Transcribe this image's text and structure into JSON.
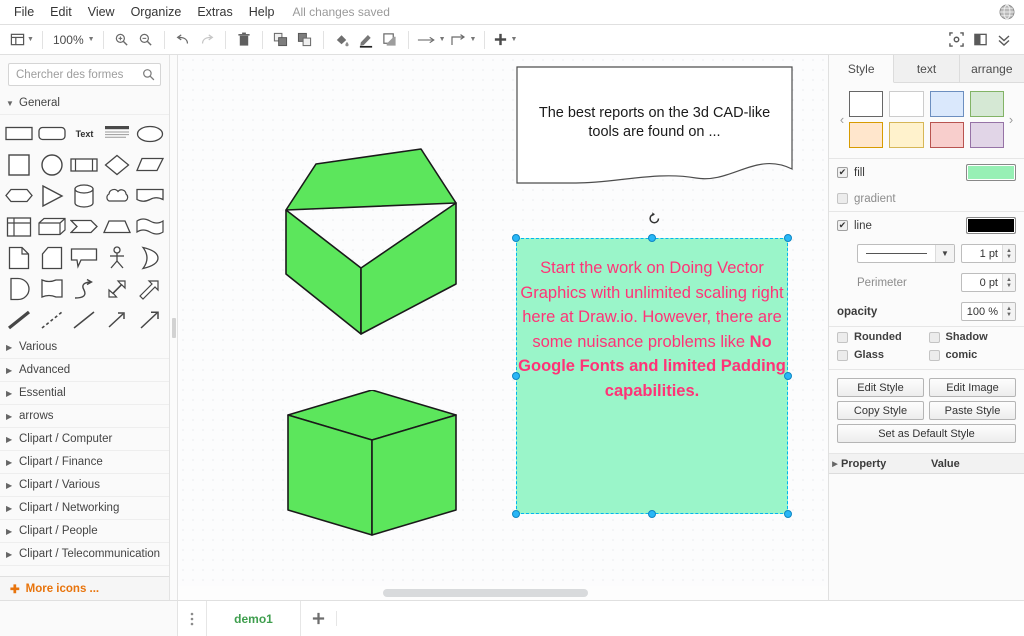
{
  "menubar": {
    "items": [
      "File",
      "Edit",
      "View",
      "Organize",
      "Extras",
      "Help"
    ],
    "status": "All changes saved",
    "language_icon": "globe-icon"
  },
  "toolbar": {
    "view_icon": "view-layout-icon",
    "zoom_level": "100%",
    "zoom_in_icon": "zoom-in-icon",
    "zoom_out_icon": "zoom-out-icon",
    "undo_icon": "undo-icon",
    "redo_icon": "redo-icon",
    "delete_icon": "trash-icon",
    "to_front_icon": "bring-to-front-icon",
    "to_back_icon": "send-to-back-icon",
    "fill_color_icon": "fill-color-icon",
    "line_color_icon": "line-color-icon",
    "shadow_icon": "shadow-icon",
    "waypoints_icon": "straight-connector-icon",
    "connection_icon": "elbow-connector-icon",
    "insert_icon": "plus-icon",
    "fullscreen_icon": "fullscreen-icon",
    "format_panel_icon": "format-panel-icon",
    "collapse_icon": "double-chevron-down-icon"
  },
  "sidebar": {
    "search_placeholder": "Chercher des formes",
    "search_value": "",
    "search_icon": "search-icon",
    "sections": [
      {
        "label": "General",
        "expanded": true
      },
      {
        "label": "Various",
        "expanded": false
      },
      {
        "label": "Advanced",
        "expanded": false
      },
      {
        "label": "Essential",
        "expanded": false
      },
      {
        "label": "arrows",
        "expanded": false
      },
      {
        "label": "Clipart / Computer",
        "expanded": false
      },
      {
        "label": "Clipart / Finance",
        "expanded": false
      },
      {
        "label": "Clipart / Various",
        "expanded": false
      },
      {
        "label": "Clipart / Networking",
        "expanded": false
      },
      {
        "label": "Clipart / People",
        "expanded": false
      },
      {
        "label": "Clipart / Telecommunication",
        "expanded": false
      }
    ],
    "shapes": [
      "rectangle",
      "rounded-rectangle",
      "text",
      "textbox",
      "ellipse",
      "square",
      "circle",
      "process",
      "rhombus",
      "parallelogram",
      "hexagon",
      "triangle",
      "cylinder",
      "cloud",
      "document",
      "internal-storage",
      "cube",
      "step",
      "trapezoid",
      "tape",
      "note",
      "card",
      "callout",
      "actor",
      "or",
      "delay",
      "data-storage",
      "curve",
      "double-arrow",
      "single-arrow",
      "line-thick",
      "line-dashed",
      "line-plain",
      "arrow-small",
      "arrow-thin"
    ],
    "more_icons_label": "More icons ...",
    "more_icons_plus": "plus-icon"
  },
  "canvas": {
    "document_shape": {
      "text": "The best reports on the 3d  CAD-like tools are found on ..."
    },
    "selected_shape": {
      "text_plain": "Start the work on Doing Vector Graphics with unlimited scaling right here at Draw.io. However, there are some nuisance problems like ",
      "text_bold": "No Google Fonts and limited Padding capabilities.",
      "fill_color": "#9af5c9",
      "text_color": "#ff3377",
      "selection_color": "#29b6f6",
      "rotate_icon": "rotate-icon"
    },
    "cube_fill": "#5CE65C",
    "cube_stroke": "#000000"
  },
  "format_panel": {
    "tabs": [
      {
        "label": "Style",
        "active": true
      },
      {
        "label": "text",
        "active": false
      },
      {
        "label": "arrange",
        "active": false
      }
    ],
    "prev_icon": "chevron-left-icon",
    "next_icon": "chevron-right-icon",
    "swatches": [
      {
        "fill": "#ffffff",
        "stroke": "#666666"
      },
      {
        "fill": "#ffffff",
        "stroke": "#cccccc"
      },
      {
        "fill": "#dae8fc",
        "stroke": "#6c8ebf"
      },
      {
        "fill": "#d5e8d4",
        "stroke": "#82b366"
      },
      {
        "fill": "#ffe6cc",
        "stroke": "#d79b00"
      },
      {
        "fill": "#fff2cc",
        "stroke": "#d6b656"
      },
      {
        "fill": "#f8cecc",
        "stroke": "#b85450"
      },
      {
        "fill": "#e1d5e7",
        "stroke": "#9673a6"
      }
    ],
    "fill": {
      "label": "fill",
      "checked": true,
      "color": "#97f0b5"
    },
    "gradient": {
      "label": "gradient",
      "checked": false
    },
    "line": {
      "label": "line",
      "checked": true,
      "color": "#000000"
    },
    "line_width": "1 pt",
    "perimeter": {
      "label": "Perimeter",
      "value": "0 pt"
    },
    "opacity": {
      "label": "opacity",
      "value": "100 %"
    },
    "toggles": [
      {
        "label": "Rounded",
        "checked": false
      },
      {
        "label": "Shadow",
        "checked": false
      },
      {
        "label": "Glass",
        "checked": false
      },
      {
        "label": "comic",
        "checked": false
      }
    ],
    "buttons": {
      "edit_style": "Edit Style",
      "edit_image": "Edit Image",
      "copy_style": "Copy Style",
      "paste_style": "Paste Style",
      "set_default": "Set as Default Style"
    },
    "property_table": {
      "col_property": "Property",
      "col_value": "Value"
    }
  },
  "footer": {
    "kebab_icon": "more-options-icon",
    "pages": [
      {
        "label": "demo1",
        "active": true
      }
    ],
    "add_page_icon": "plus-icon"
  }
}
